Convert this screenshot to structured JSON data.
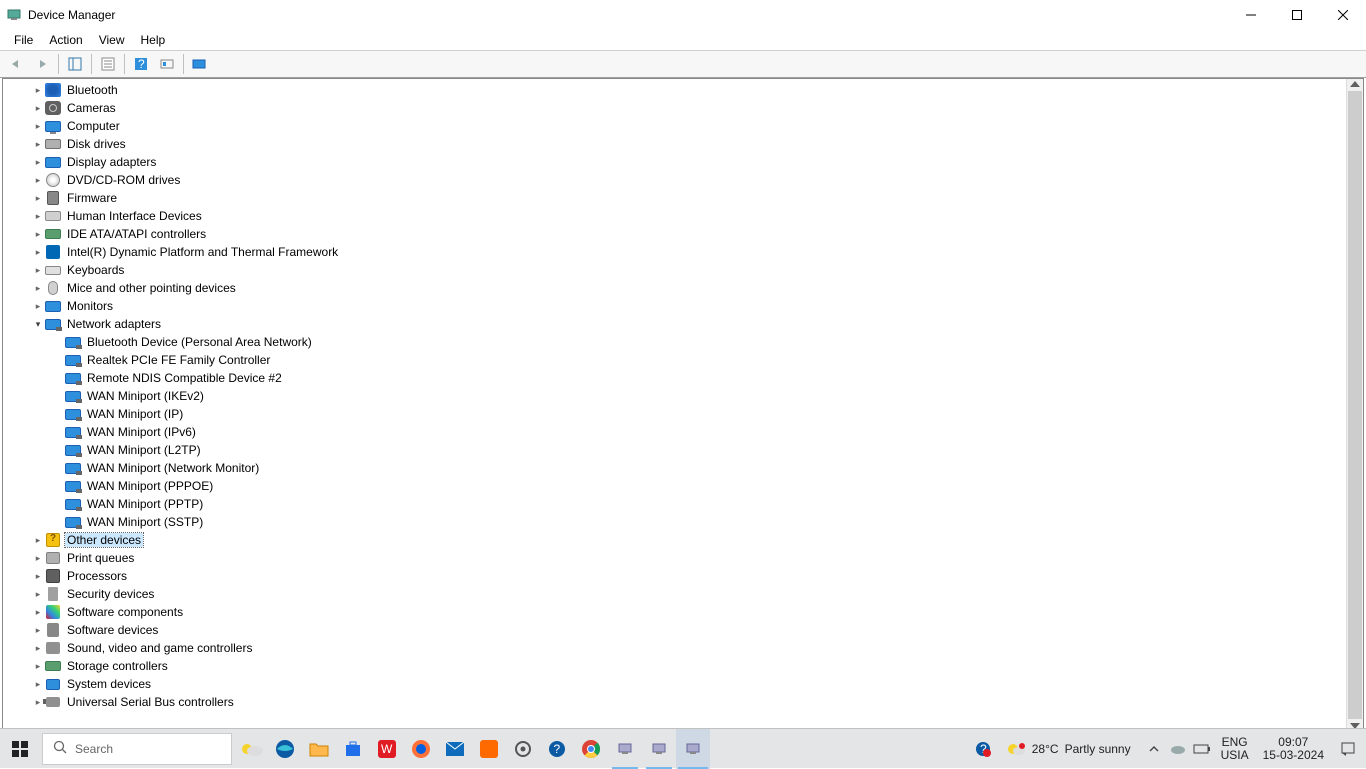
{
  "window": {
    "title": "Device Manager"
  },
  "menubar": [
    "File",
    "Action",
    "View",
    "Help"
  ],
  "tree": {
    "categories": [
      {
        "name": "Bluetooth",
        "icon": "bt"
      },
      {
        "name": "Cameras",
        "icon": "cam"
      },
      {
        "name": "Computer",
        "icon": "comp"
      },
      {
        "name": "Disk drives",
        "icon": "disk"
      },
      {
        "name": "Display adapters",
        "icon": "disp"
      },
      {
        "name": "DVD/CD-ROM drives",
        "icon": "dvd"
      },
      {
        "name": "Firmware",
        "icon": "fw"
      },
      {
        "name": "Human Interface Devices",
        "icon": "hid"
      },
      {
        "name": "IDE ATA/ATAPI controllers",
        "icon": "ide"
      },
      {
        "name": "Intel(R) Dynamic Platform and Thermal Framework",
        "icon": "intel"
      },
      {
        "name": "Keyboards",
        "icon": "kb"
      },
      {
        "name": "Mice and other pointing devices",
        "icon": "mouse"
      },
      {
        "name": "Monitors",
        "icon": "mon"
      },
      {
        "name": "Network adapters",
        "icon": "net",
        "expanded": true,
        "children": [
          "Bluetooth Device (Personal Area Network)",
          "Realtek PCIe FE Family Controller",
          "Remote NDIS Compatible Device #2",
          "WAN Miniport (IKEv2)",
          "WAN Miniport (IP)",
          "WAN Miniport (IPv6)",
          "WAN Miniport (L2TP)",
          "WAN Miniport (Network Monitor)",
          "WAN Miniport (PPPOE)",
          "WAN Miniport (PPTP)",
          "WAN Miniport (SSTP)"
        ]
      },
      {
        "name": "Other devices",
        "icon": "oth",
        "selected": true
      },
      {
        "name": "Print queues",
        "icon": "prn"
      },
      {
        "name": "Processors",
        "icon": "cpu"
      },
      {
        "name": "Security devices",
        "icon": "sec"
      },
      {
        "name": "Software components",
        "icon": "swc"
      },
      {
        "name": "Software devices",
        "icon": "swd"
      },
      {
        "name": "Sound, video and game controllers",
        "icon": "snd"
      },
      {
        "name": "Storage controllers",
        "icon": "stor"
      },
      {
        "name": "System devices",
        "icon": "sys"
      },
      {
        "name": "Universal Serial Bus controllers",
        "icon": "usb"
      }
    ]
  },
  "taskbar": {
    "search_placeholder": "Search",
    "weather_temp": "28°C",
    "weather_cond": "Partly sunny",
    "lang1": "ENG",
    "lang2": "USIA",
    "time": "09:07",
    "date": "15-03-2024"
  }
}
